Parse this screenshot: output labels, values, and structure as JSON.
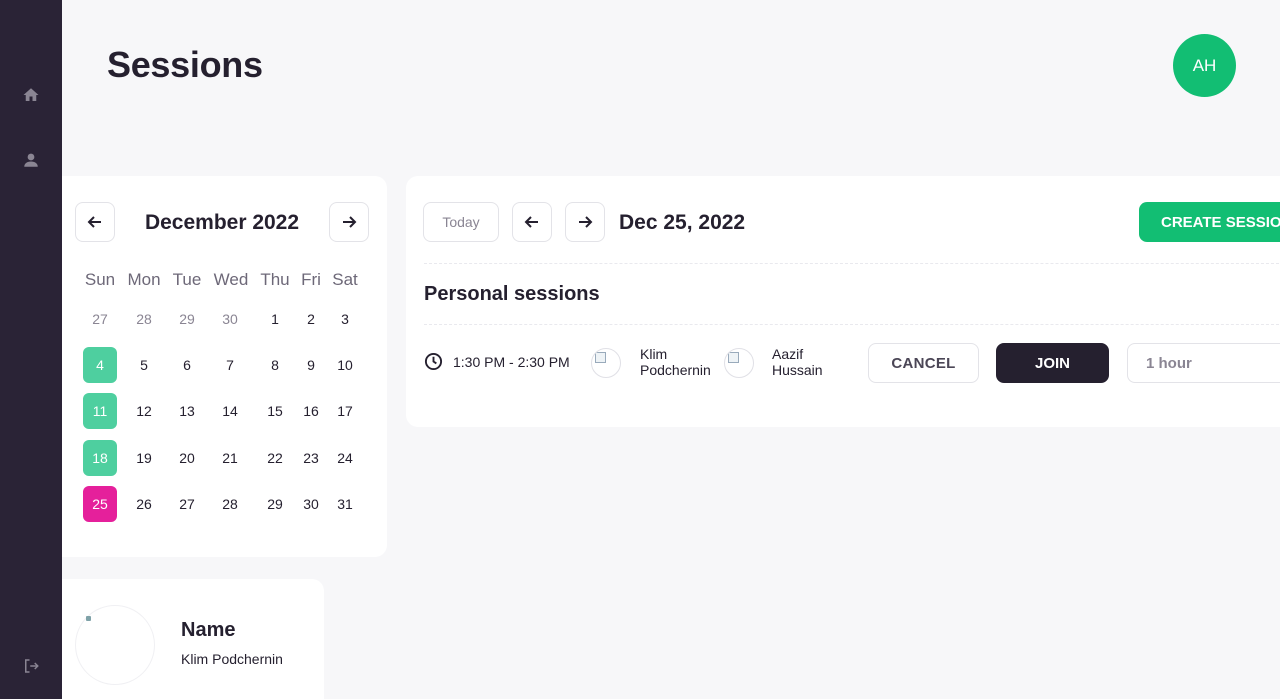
{
  "header": {
    "title": "Sessions",
    "avatar_initials": "AH"
  },
  "sidebar": {
    "items": [
      "home-icon",
      "user-icon",
      "logout-icon"
    ]
  },
  "calendar": {
    "month_label": "December 2022",
    "weekdays": [
      "Sun",
      "Mon",
      "Tue",
      "Wed",
      "Thu",
      "Fri",
      "Sat"
    ],
    "weeks": [
      [
        "27",
        "28",
        "29",
        "30",
        "1",
        "2",
        "3"
      ],
      [
        "4",
        "5",
        "6",
        "7",
        "8",
        "9",
        "10"
      ],
      [
        "11",
        "12",
        "13",
        "14",
        "15",
        "16",
        "17"
      ],
      [
        "18",
        "19",
        "20",
        "21",
        "22",
        "23",
        "24"
      ],
      [
        "25",
        "26",
        "27",
        "28",
        "29",
        "30",
        "31"
      ]
    ],
    "muted_days": [
      "27",
      "28",
      "29",
      "30"
    ],
    "highlighted_days": [
      "4",
      "11",
      "18"
    ],
    "selected_day": "25",
    "colors": {
      "highlight": "#4ecf9f",
      "selected": "#e5209b"
    }
  },
  "sessions": {
    "today_label": "Today",
    "current_date": "Dec 25, 2022",
    "create_label": "CREATE SESSION",
    "section_title": "Personal sessions",
    "items": [
      {
        "time": "1:30 PM - 2:30 PM",
        "participants": [
          "Klim Podchernin",
          "Aazif Hussain"
        ],
        "cancel_label": "CANCEL",
        "join_label": "JOIN",
        "duration": "1 hour"
      }
    ]
  },
  "profile": {
    "label": "Name",
    "value": "Klim Podchernin"
  },
  "colors": {
    "sidebar": "#2a2336",
    "accent": "#12be73",
    "dark": "#25202f"
  }
}
